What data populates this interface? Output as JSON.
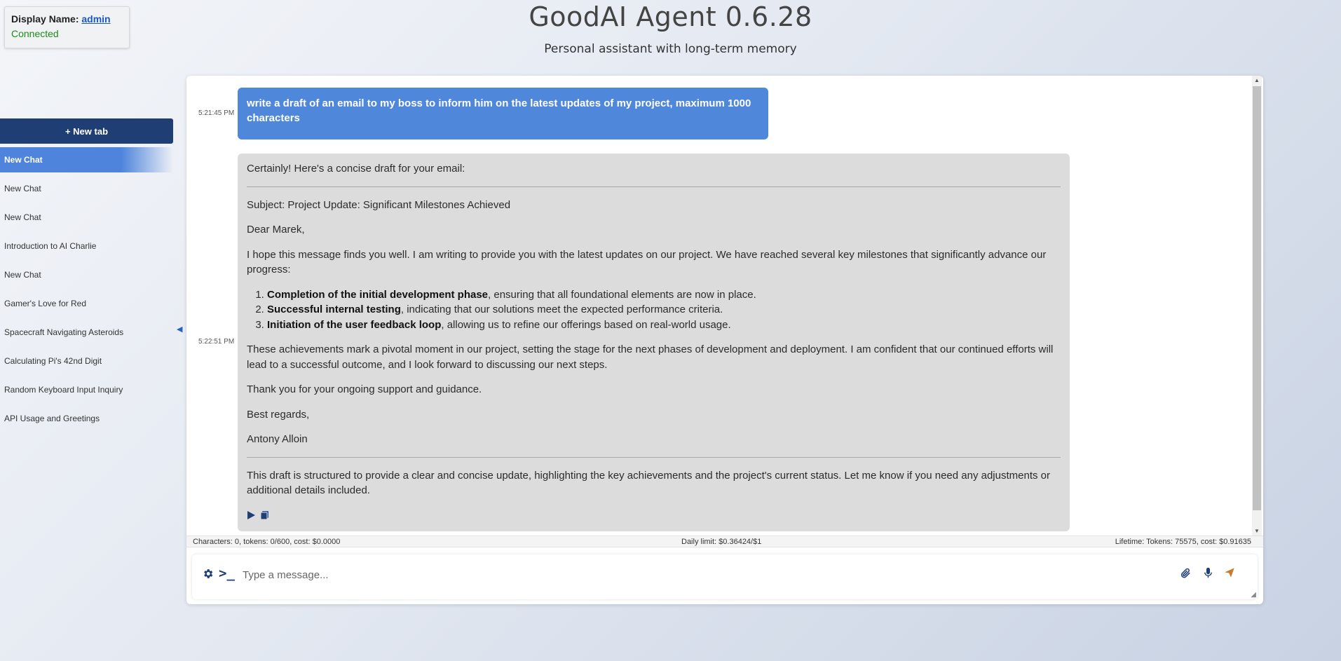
{
  "user": {
    "display_name_label": "Display Name:",
    "display_name": "admin",
    "status": "Connected"
  },
  "app": {
    "title": "GoodAI Agent 0.6.28",
    "subtitle": "Personal assistant with long-term memory"
  },
  "sidebar": {
    "new_tab_label": "+ New tab",
    "collapse_glyph": "◀",
    "items": [
      {
        "label": "New Chat",
        "active": true
      },
      {
        "label": "New Chat"
      },
      {
        "label": "New Chat"
      },
      {
        "label": "Introduction to AI Charlie"
      },
      {
        "label": "New Chat"
      },
      {
        "label": "Gamer's Love for Red"
      },
      {
        "label": "Spacecraft Navigating Asteroids"
      },
      {
        "label": "Calculating Pi's 42nd Digit"
      },
      {
        "label": "Random Keyboard Input Inquiry"
      },
      {
        "label": "API Usage and Greetings"
      }
    ]
  },
  "messages": {
    "user_time": "5:21:45 PM",
    "user_text": "write a draft of an email to my boss to inform him on the latest updates of my project, maximum 1000 characters",
    "assistant_time": "5:22:51 PM",
    "intro": "Certainly! Here's a concise draft for your email:",
    "subject": "Subject: Project Update: Significant Milestones Achieved",
    "greeting": "Dear Marek,",
    "para1": "I hope this message finds you well. I am writing to provide you with the latest updates on our project. We have reached several key milestones that significantly advance our progress:",
    "list": [
      {
        "bold": "Completion of the initial development phase",
        "rest": ", ensuring that all foundational elements are now in place."
      },
      {
        "bold": "Successful internal testing",
        "rest": ", indicating that our solutions meet the expected performance criteria."
      },
      {
        "bold": "Initiation of the user feedback loop",
        "rest": ", allowing us to refine our offerings based on real-world usage."
      }
    ],
    "para2": "These achievements mark a pivotal moment in our project, setting the stage for the next phases of development and deployment. I am confident that our continued efforts will lead to a successful outcome, and I look forward to discussing our next steps.",
    "para3": "Thank you for your ongoing support and guidance.",
    "closing": "Best regards,",
    "signature": "Antony Alloin",
    "outro": "This draft is structured to provide a clear and concise update, highlighting the key achievements and the project's current status. Let me know if you need any adjustments or additional details included."
  },
  "status_bar": {
    "left": "Characters: 0, tokens: 0/600, cost: $0.0000",
    "middle": "Daily limit: $0.36424/$1",
    "right": "Lifetime: Tokens: 75575, cost: $0.91635"
  },
  "input": {
    "placeholder": "Type a message...",
    "value": ""
  },
  "icons": {
    "settings": "gear-icon",
    "terminal": "terminal-icon",
    "attach": "paperclip-icon",
    "mic": "microphone-icon",
    "send": "send-icon",
    "play": "play-icon",
    "copy": "copy-icon"
  }
}
